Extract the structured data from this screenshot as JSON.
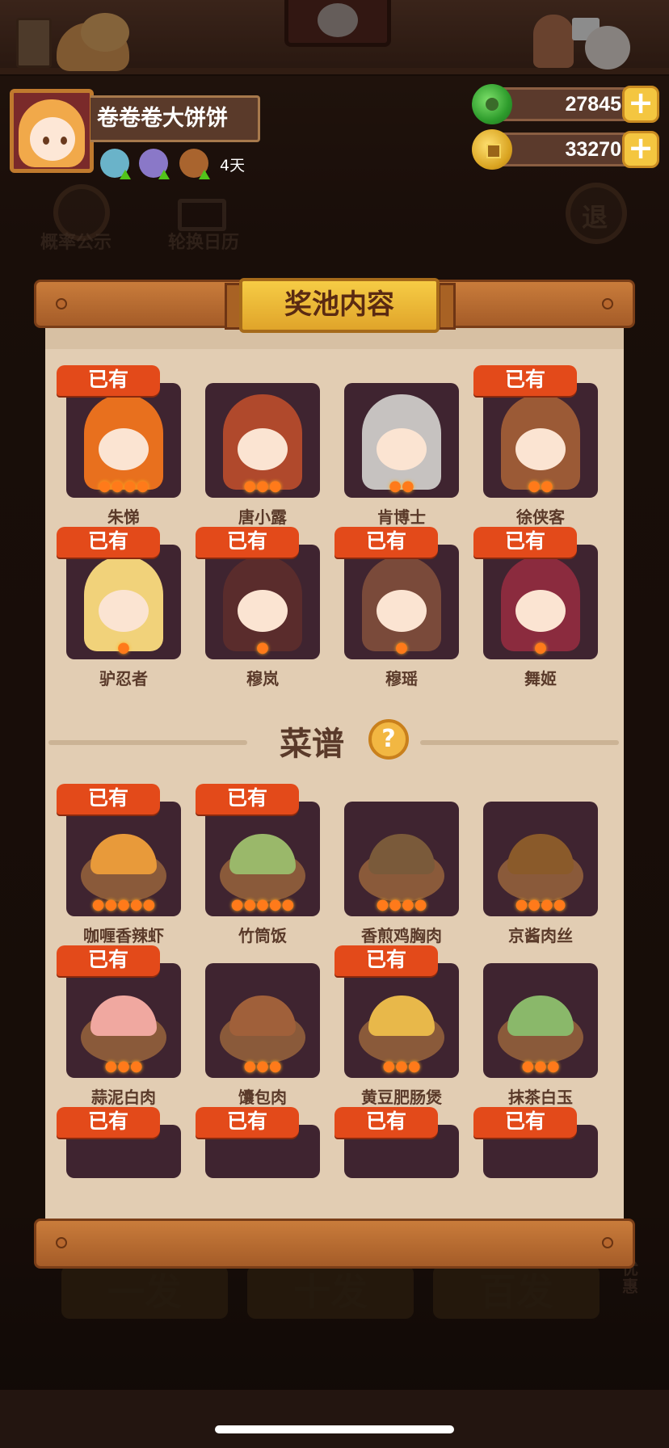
{
  "header": {
    "player_name": "卷卷卷大饼饼",
    "buffs": [
      "shaved-ice-buff-icon",
      "chef-buff-icon",
      "tools-buff-icon"
    ],
    "days": "4天"
  },
  "currency": {
    "jade": "27845",
    "coins": "33270",
    "add_symbol": "+"
  },
  "background": {
    "probability_label": "概率公示",
    "calendar_label": "轮换日历",
    "exit_label": "退",
    "buttons": [
      "一发",
      "十发",
      "百发"
    ],
    "side_label": "优惠"
  },
  "modal": {
    "title": "奖池内容",
    "owned_tag": "已有",
    "characters": [
      {
        "name": "朱悌",
        "owned": true,
        "flames": 4,
        "color": "#e8701e"
      },
      {
        "name": "唐小露",
        "owned": false,
        "flames": 3,
        "color": "#b0492c"
      },
      {
        "name": "肯博士",
        "owned": false,
        "flames": 2,
        "color": "#c6c2c0"
      },
      {
        "name": "徐侠客",
        "owned": true,
        "flames": 2,
        "color": "#9b5a36"
      },
      {
        "name": "驴忍者",
        "owned": true,
        "flames": 1,
        "color": "#f1d27a"
      },
      {
        "name": "穆岚",
        "owned": true,
        "flames": 1,
        "color": "#5a2c2c"
      },
      {
        "name": "穆瑶",
        "owned": true,
        "flames": 1,
        "color": "#7a4a3a"
      },
      {
        "name": "舞姬",
        "owned": true,
        "flames": 1,
        "color": "#8b2b3e"
      }
    ],
    "recipes_title": "菜谱",
    "recipes": [
      {
        "name": "咖喱香辣虾",
        "owned": true,
        "flames": 5,
        "color": "#e89a3a"
      },
      {
        "name": "竹筒饭",
        "owned": true,
        "flames": 5,
        "color": "#9ab86a"
      },
      {
        "name": "香煎鸡胸肉",
        "owned": false,
        "flames": 4,
        "color": "#7a5a3a"
      },
      {
        "name": "京酱肉丝",
        "owned": false,
        "flames": 4,
        "color": "#8a5a2a"
      },
      {
        "name": "蒜泥白肉",
        "owned": true,
        "flames": 3,
        "color": "#f0a8a0"
      },
      {
        "name": "馕包肉",
        "owned": false,
        "flames": 3,
        "color": "#a0603a"
      },
      {
        "name": "黄豆肥肠煲",
        "owned": true,
        "flames": 3,
        "color": "#e8b84a"
      },
      {
        "name": "抹茶白玉",
        "owned": false,
        "flames": 3,
        "color": "#8ab86a"
      },
      {
        "name": "",
        "owned": true,
        "flames": 0,
        "color": "#3f2430"
      },
      {
        "name": "",
        "owned": true,
        "flames": 0,
        "color": "#3f2430"
      },
      {
        "name": "",
        "owned": true,
        "flames": 0,
        "color": "#3f2430"
      },
      {
        "name": "",
        "owned": true,
        "flames": 0,
        "color": "#3f2430"
      }
    ]
  }
}
